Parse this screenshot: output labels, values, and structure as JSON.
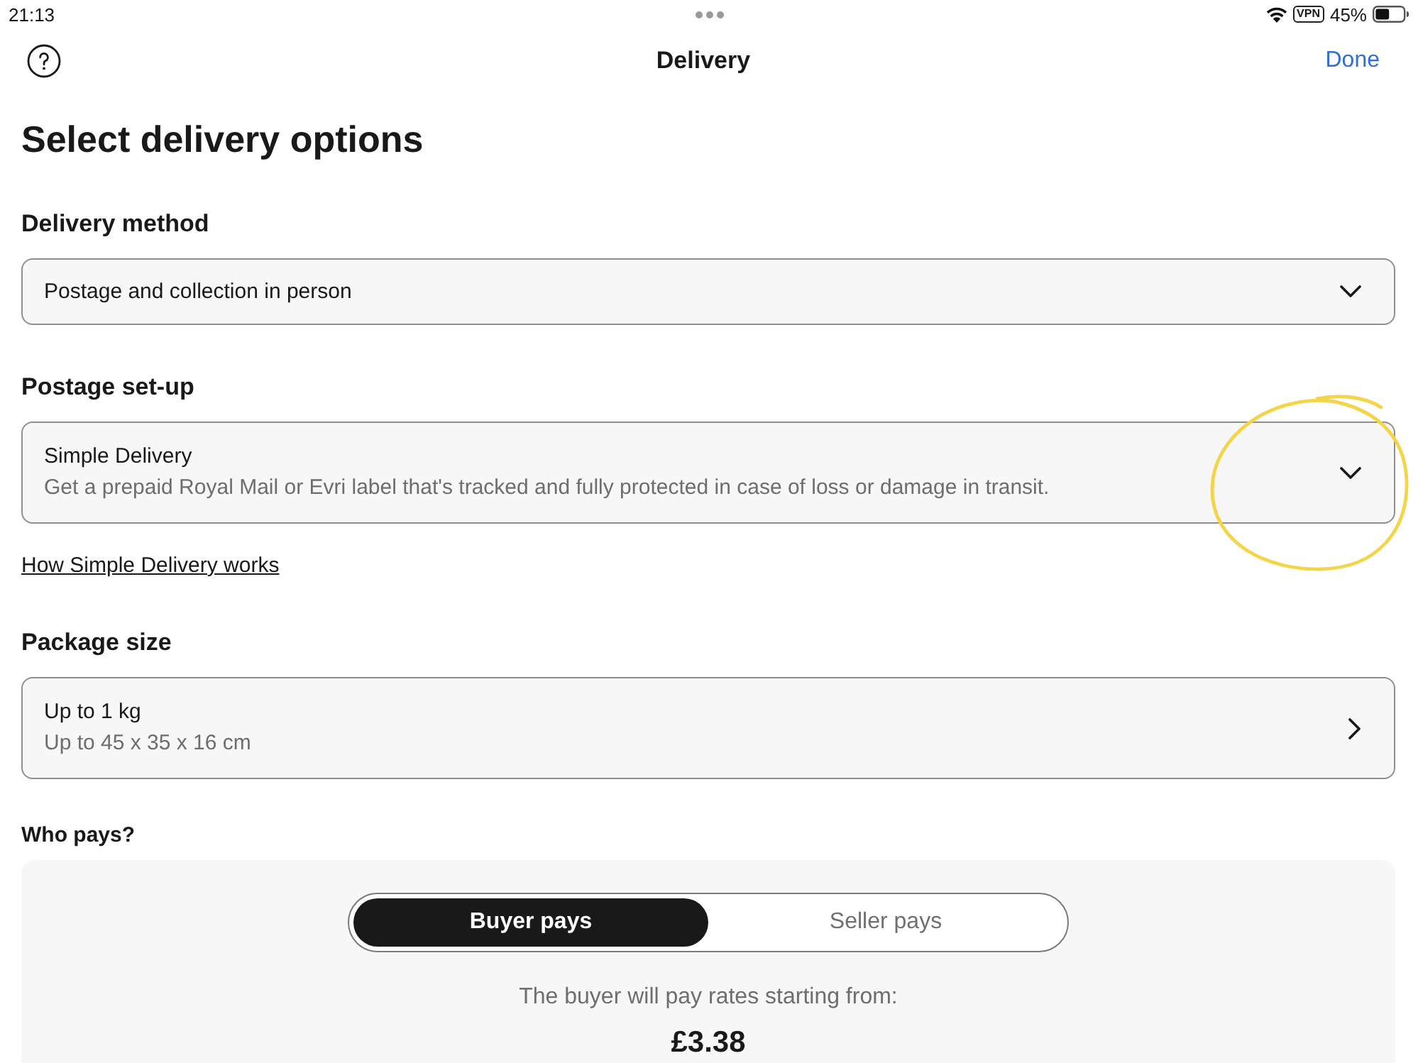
{
  "status_bar": {
    "time": "21:13",
    "vpn": "VPN",
    "battery": "45%"
  },
  "nav": {
    "title": "Delivery",
    "done": "Done"
  },
  "heading": "Select delivery options",
  "sections": [
    {
      "kind": "select",
      "label": "Delivery method",
      "value": "Postage and collection in person"
    },
    {
      "kind": "select",
      "label": "Postage set-up",
      "value": "Simple Delivery",
      "description": "Get a prepaid Royal Mail or Evri label that's tracked and fully protected in case of loss or damage in transit.",
      "link": "How Simple Delivery works"
    },
    {
      "kind": "nav",
      "label": "Package size",
      "value": "Up to 1 kg",
      "description": "Up to 45 x 35 x 16 cm"
    }
  ],
  "who_pays": {
    "label": "Who pays?",
    "options": [
      {
        "label": "Buyer pays",
        "selected": true
      },
      {
        "label": "Seller pays",
        "selected": false
      }
    ],
    "note": "The buyer will pay rates starting from:",
    "price": "£3.38"
  },
  "annotation": {
    "kind": "circle"
  }
}
